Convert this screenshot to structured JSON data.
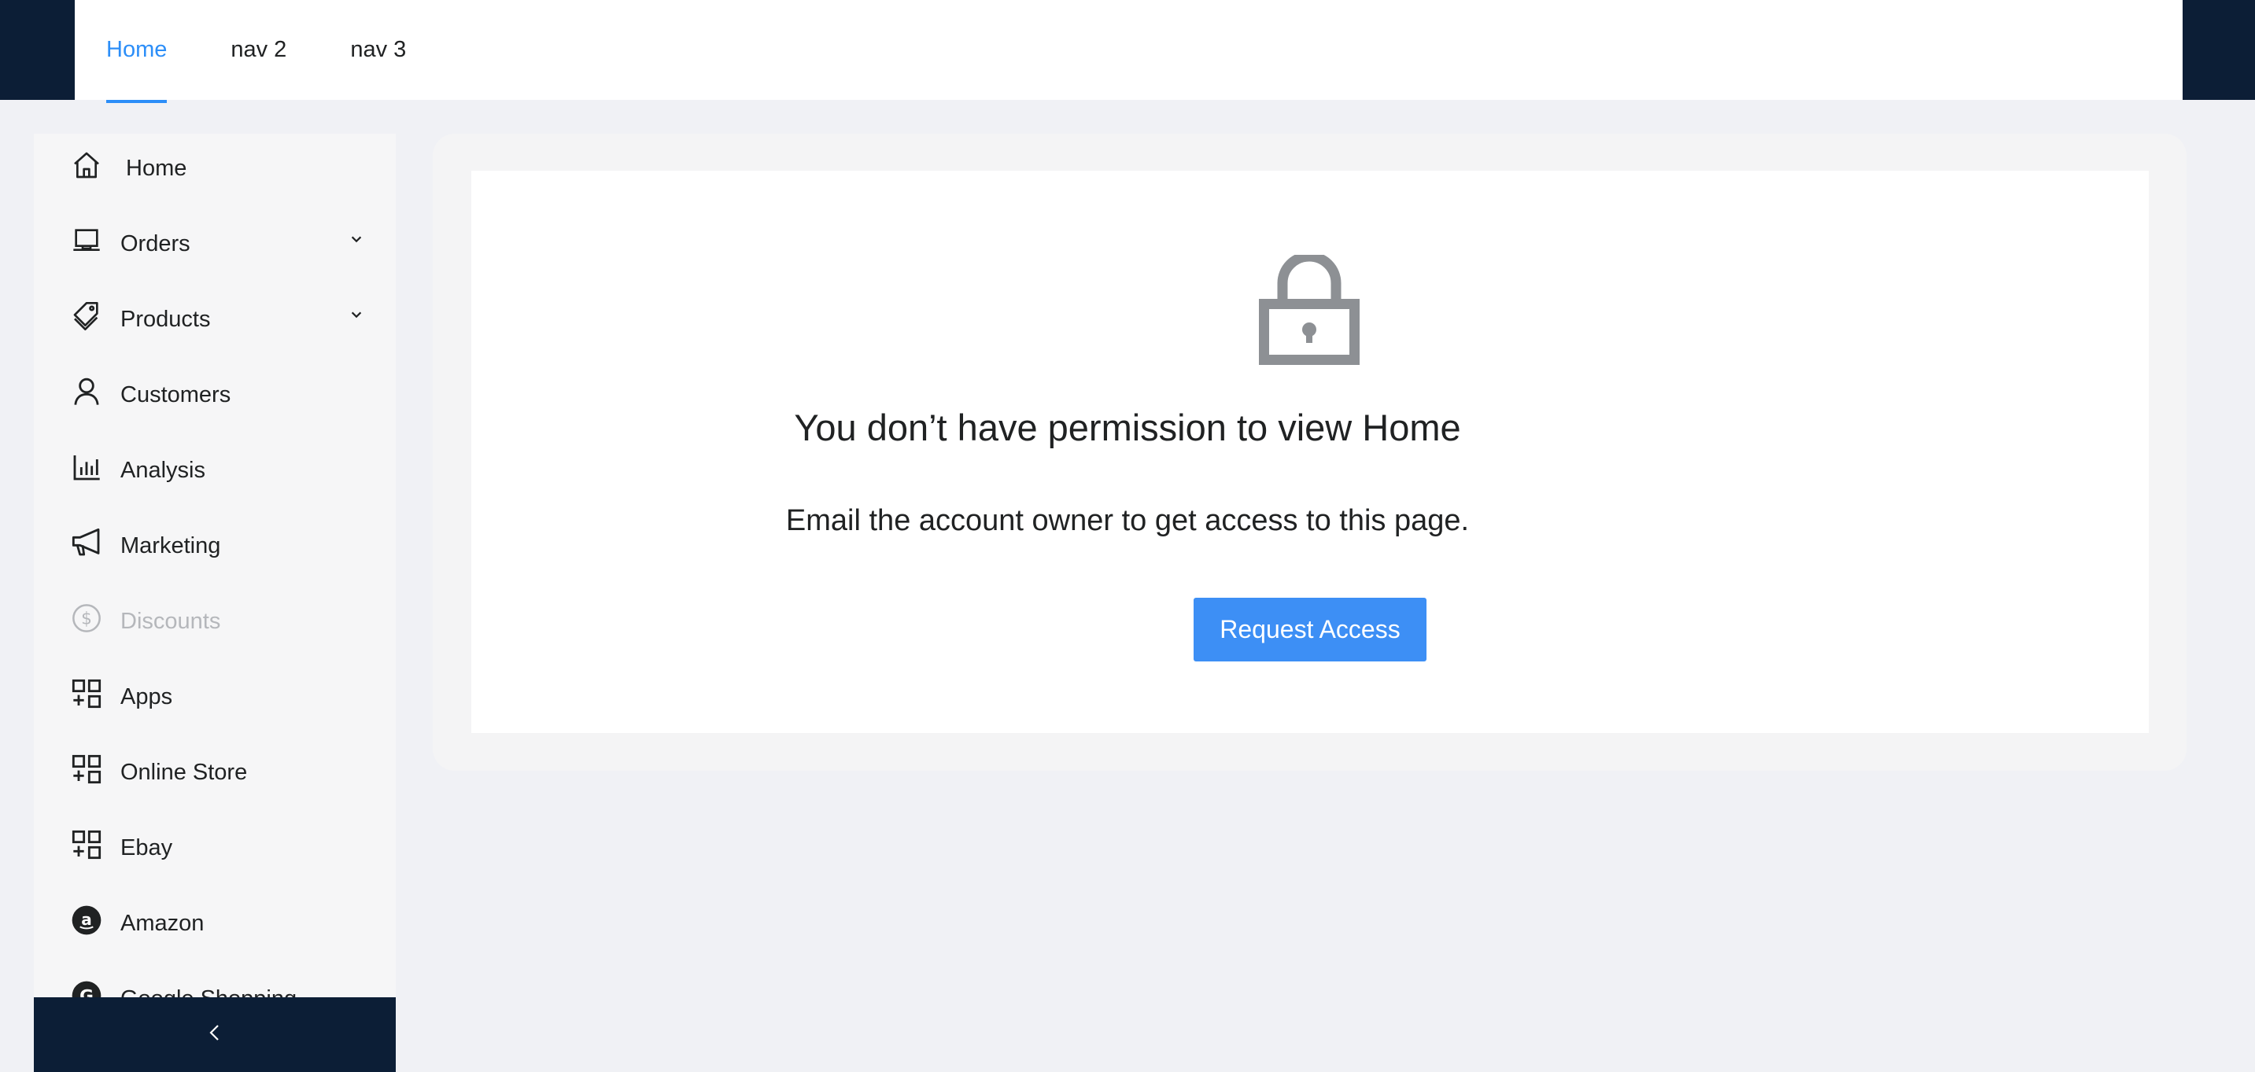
{
  "topnav": {
    "tabs": [
      {
        "label": "Home",
        "active": true
      },
      {
        "label": "nav 2",
        "active": false
      },
      {
        "label": "nav 3",
        "active": false
      }
    ]
  },
  "sidebar": {
    "items": [
      {
        "label": "Home",
        "icon": "home-icon"
      },
      {
        "label": "Orders",
        "icon": "laptop-icon",
        "expandable": true
      },
      {
        "label": "Products",
        "icon": "tag-icon",
        "expandable": true
      },
      {
        "label": "Customers",
        "icon": "person-icon"
      },
      {
        "label": "Analysis",
        "icon": "bar-chart-icon"
      },
      {
        "label": "Marketing",
        "icon": "megaphone-icon"
      },
      {
        "label": "Discounts",
        "icon": "dollar-icon",
        "disabled": true
      },
      {
        "label": "Apps",
        "icon": "apps-icon"
      },
      {
        "label": "Online Store",
        "icon": "apps-icon"
      },
      {
        "label": "Ebay",
        "icon": "apps-icon"
      },
      {
        "label": "Amazon",
        "icon": "amazon-icon"
      },
      {
        "label": "Google Shopping",
        "icon": "google-icon"
      }
    ],
    "collapse_icon": "chevron-left-icon"
  },
  "main": {
    "title": "You don’t have permission to view Home",
    "subtitle": "Email the account owner to get access to this page.",
    "button_label": "Request Access",
    "icon": "lock-icon"
  },
  "colors": {
    "accent": "#2c8ef8",
    "button": "#3d8ff5",
    "dark_nav": "#0c1e36",
    "disabled_text": "#b5b7bb"
  }
}
